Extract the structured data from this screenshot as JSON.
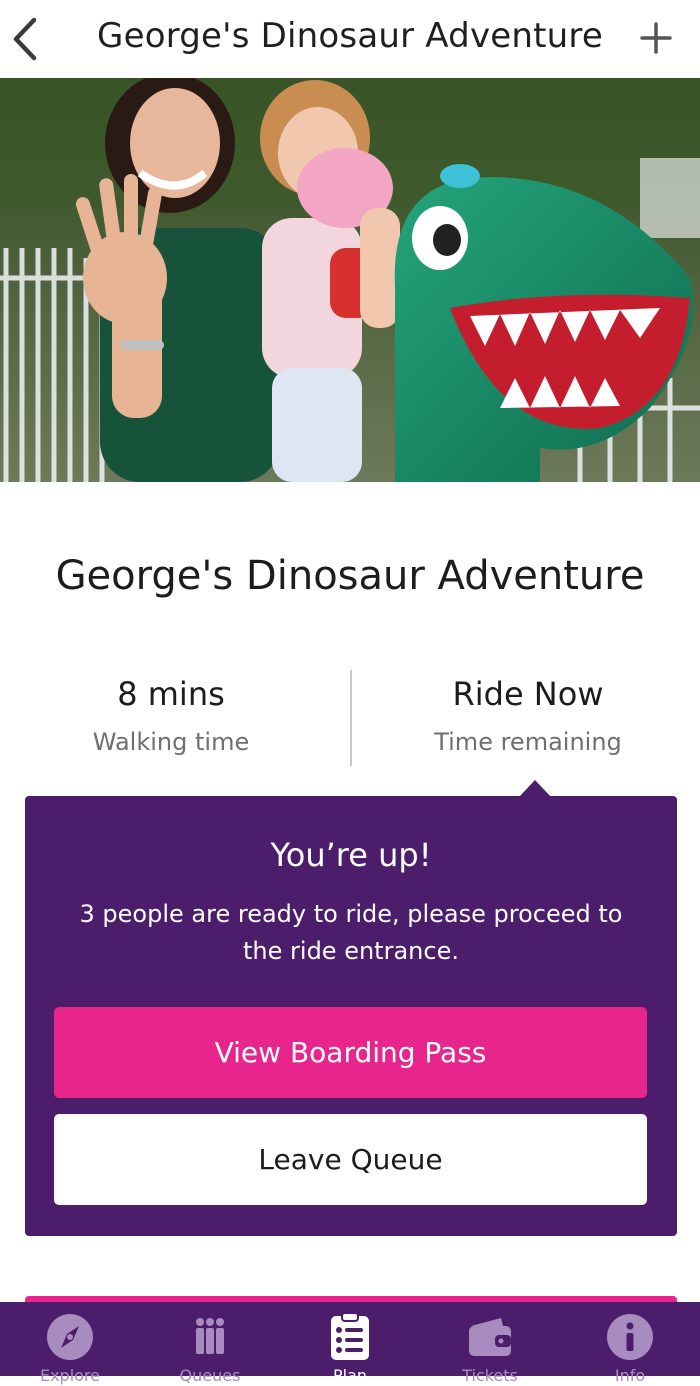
{
  "header": {
    "title": "George's Dinosaur Adventure"
  },
  "ride": {
    "title": "George's Dinosaur Adventure"
  },
  "stats": {
    "walking_value": "8 mins",
    "walking_label": "Walking time",
    "remaining_value": "Ride Now",
    "remaining_label": "Time remaining"
  },
  "notice": {
    "title": "You’re up!",
    "message": "3 people are ready to ride, please proceed to the ride entrance.",
    "boarding_button": "View Boarding Pass",
    "leave_button": "Leave Queue"
  },
  "tabs": [
    {
      "label": "Explore",
      "icon": "compass-icon",
      "active": false
    },
    {
      "label": "Queues",
      "icon": "people-queue-icon",
      "active": false
    },
    {
      "label": "Plan",
      "icon": "clipboard-list-icon",
      "active": true
    },
    {
      "label": "Tickets",
      "icon": "wallet-icon",
      "active": false
    },
    {
      "label": "Info",
      "icon": "info-icon",
      "active": false
    }
  ],
  "colors": {
    "brand_purple": "#4b1d6a",
    "accent_pink": "#e8258d",
    "dino_green": "#1e9a72"
  }
}
